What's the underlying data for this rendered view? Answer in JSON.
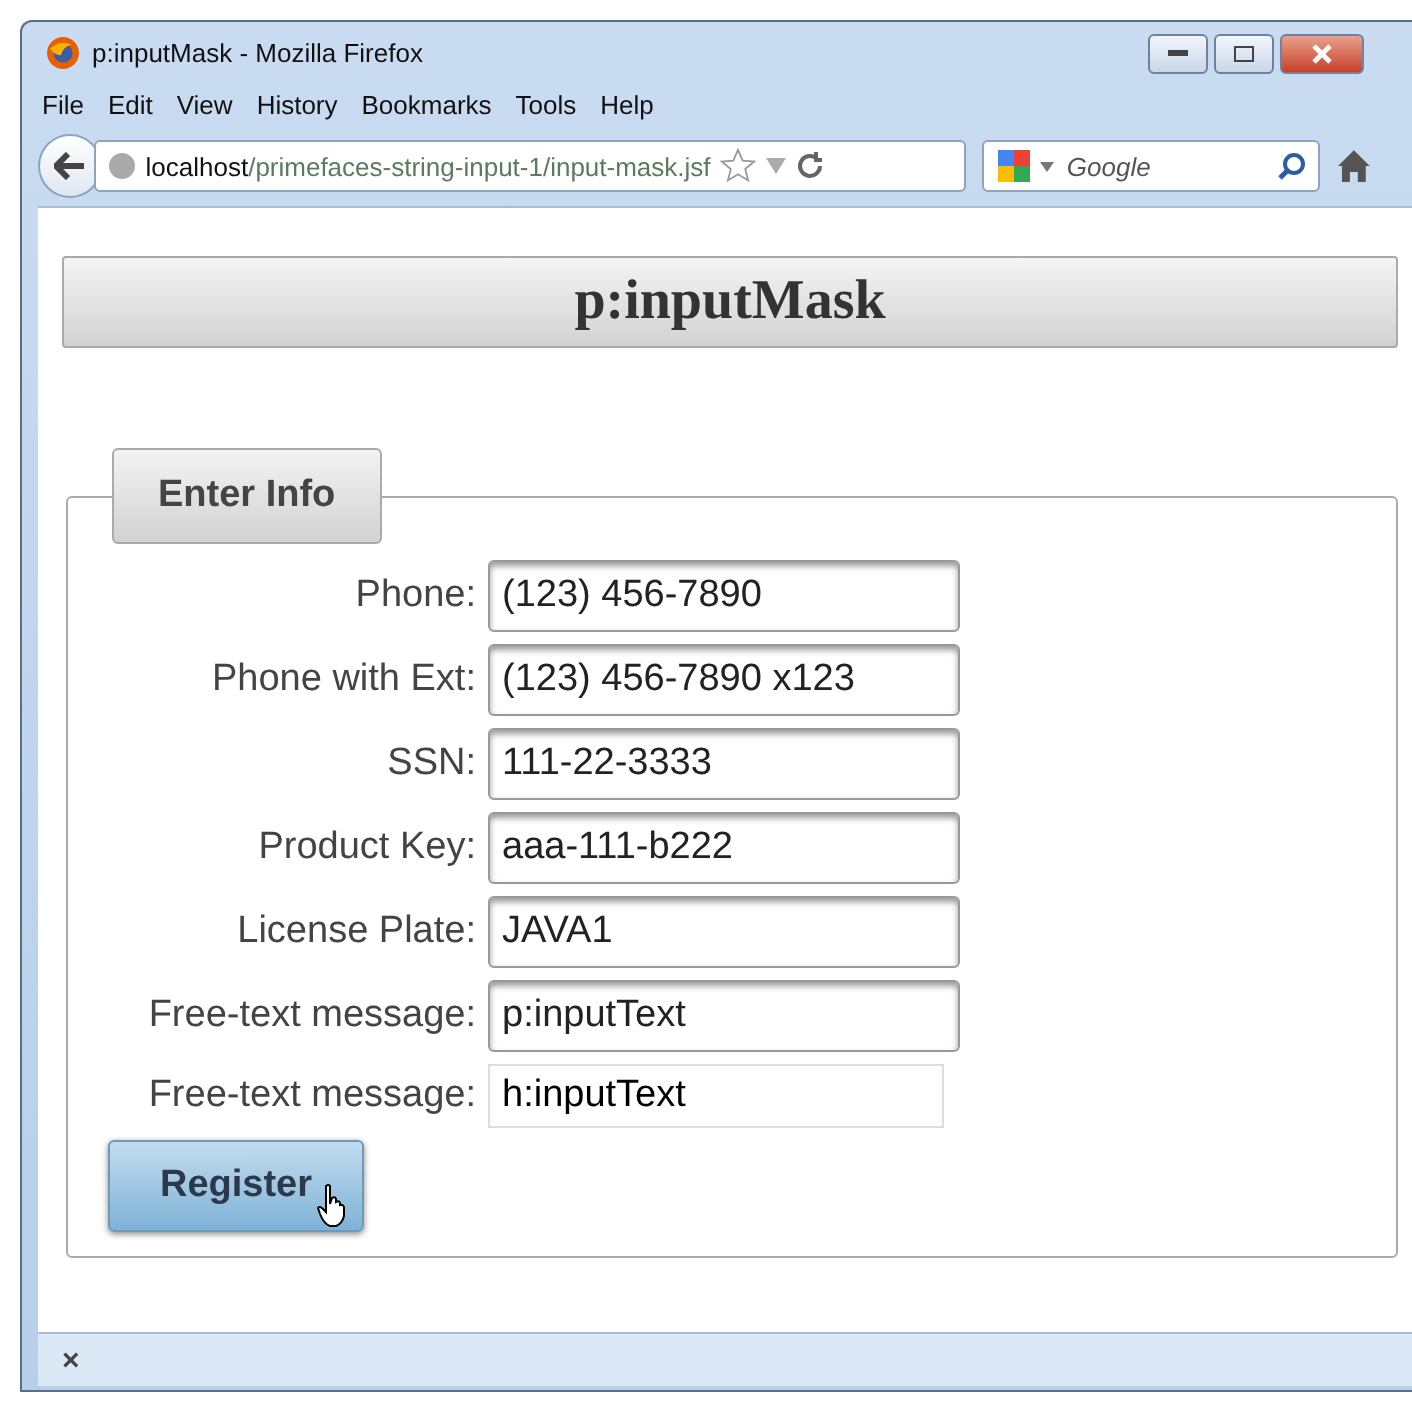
{
  "window": {
    "title": "p:inputMask - Mozilla Firefox"
  },
  "menu": [
    "File",
    "Edit",
    "View",
    "History",
    "Bookmarks",
    "Tools",
    "Help"
  ],
  "address": {
    "host": "localhost",
    "path": "/primefaces-string-input-1/input-mask.jsf"
  },
  "search": {
    "placeholder": "Google"
  },
  "page": {
    "heading": "p:inputMask",
    "legend": "Enter Info",
    "fields": [
      {
        "label": "Phone:",
        "value": "(123) 456-7890",
        "kind": "mask"
      },
      {
        "label": "Phone with Ext:",
        "value": "(123) 456-7890 x123",
        "kind": "mask"
      },
      {
        "label": "SSN:",
        "value": "111-22-3333",
        "kind": "mask"
      },
      {
        "label": "Product Key:",
        "value": "aaa-111-b222",
        "kind": "mask"
      },
      {
        "label": "License Plate:",
        "value": "JAVA1",
        "kind": "mask"
      },
      {
        "label": "Free-text message:",
        "value": "p:inputText",
        "kind": "mask"
      },
      {
        "label": "Free-text message:",
        "value": "h:inputText",
        "kind": "plain"
      }
    ],
    "button": "Register"
  },
  "status_bar": {
    "close": "×"
  }
}
